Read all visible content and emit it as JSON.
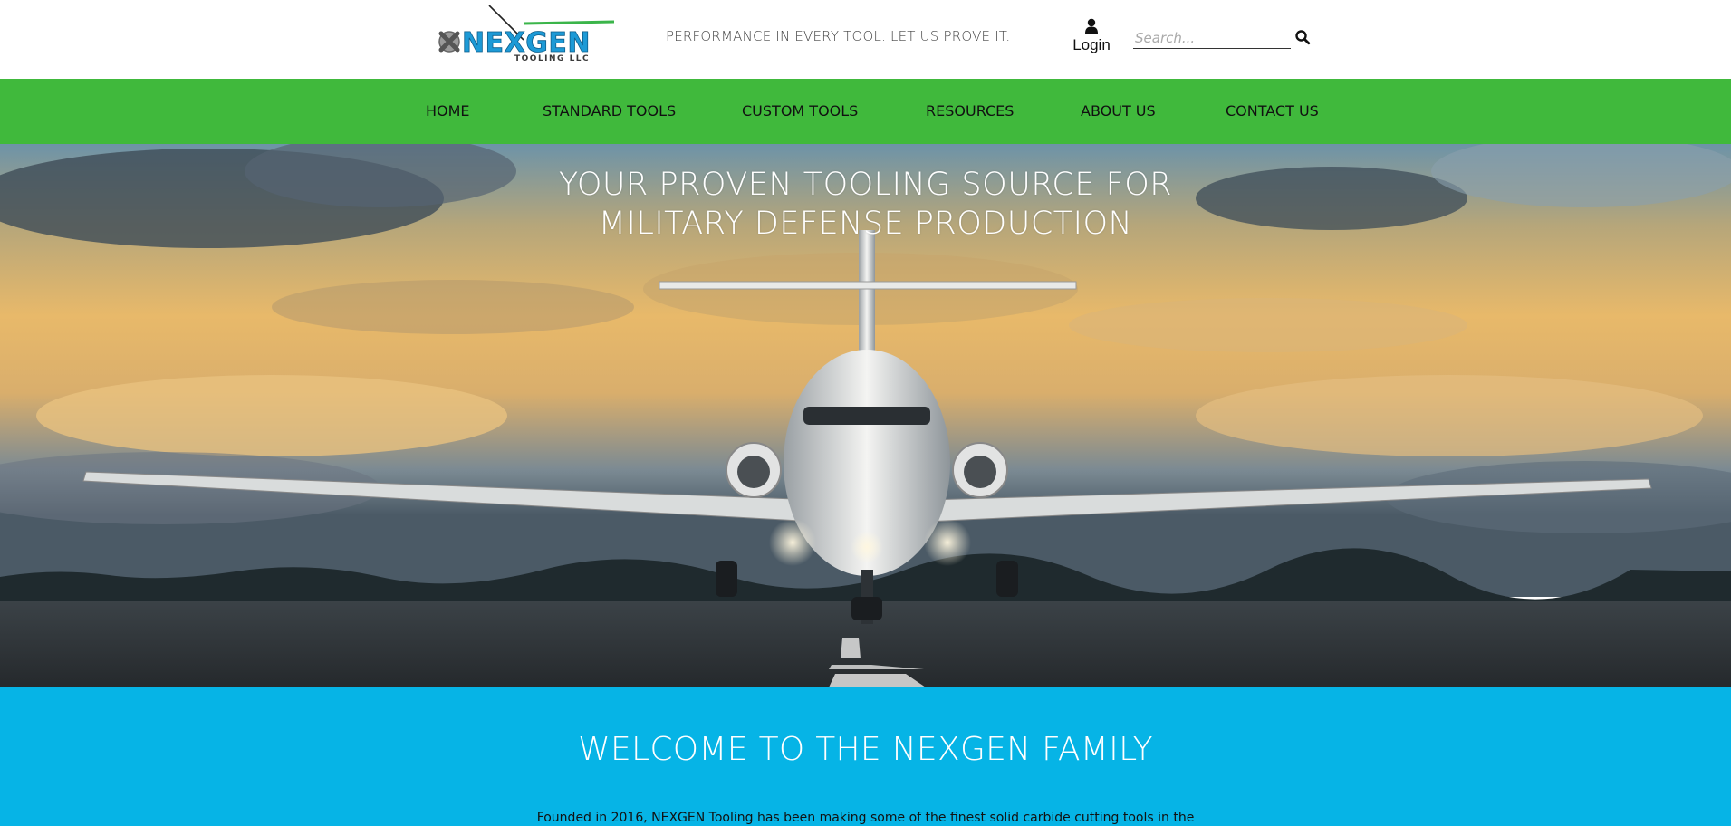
{
  "header": {
    "logo": {
      "word": "NEXGEN",
      "sub": "TOOLING LLC"
    },
    "tagline": "PERFORMANCE IN EVERY TOOL. LET US PROVE IT.",
    "login_label": "Login",
    "search_placeholder": "Search...",
    "icons": {
      "login": "user-icon",
      "search": "search-icon"
    }
  },
  "nav": {
    "items": [
      {
        "label": "HOME"
      },
      {
        "label": "STANDARD TOOLS"
      },
      {
        "label": "CUSTOM TOOLS"
      },
      {
        "label": "RESOURCES"
      },
      {
        "label": "ABOUT US"
      },
      {
        "label": "CONTACT US"
      }
    ]
  },
  "hero": {
    "title_line1": "YOUR PROVEN TOOLING SOURCE FOR",
    "title_line2": "MILITARY DEFENSE PRODUCTION"
  },
  "welcome": {
    "title": "WELCOME TO THE NEXGEN FAMILY",
    "text": "Founded in 2016, NEXGEN Tooling has been making some of the finest solid carbide cutting tools in the"
  },
  "colors": {
    "nav_green": "#40b93c",
    "welcome_blue": "#06b4e6",
    "logo_blue": "#1d9ad6",
    "logo_green": "#3bb54a"
  }
}
